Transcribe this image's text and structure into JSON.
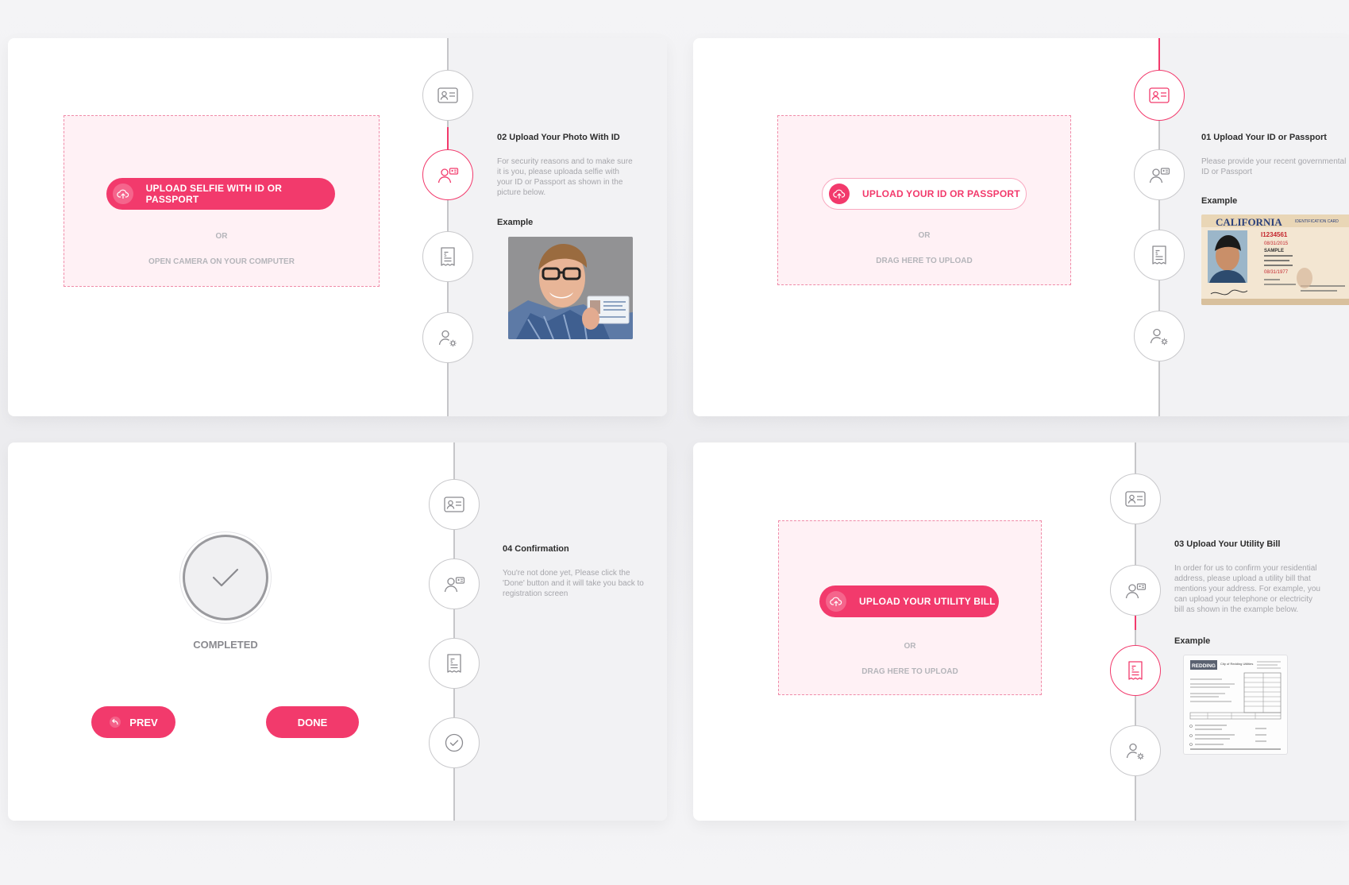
{
  "colors": {
    "accent": "#f23a6c",
    "dropzone_bg": "#fff1f5",
    "sidebar_bg": "#f2f2f4",
    "muted_text": "#a6a6ab"
  },
  "step_icons": [
    "id-card-icon",
    "selfie-with-id-icon",
    "utility-bill-icon",
    "user-settings-icon",
    "checkmark-icon"
  ],
  "panel_selfie": {
    "button_label": "UPLOAD SELFIE WITH ID OR PASSPORT",
    "or_label": "OR",
    "secondary_label": "OPEN CAMERA ON YOUR COMPUTER",
    "step_title": "02 Upload Your Photo With ID",
    "step_desc": "For security reasons and to make sure it is you, please uploada selfie with your ID or Passport as shown in the picture below.",
    "example_label": "Example",
    "active_step": 2
  },
  "panel_id": {
    "button_label": "UPLOAD YOUR ID OR PASSPORT",
    "or_label": "OR",
    "secondary_label": "DRAG HERE TO UPLOAD",
    "step_title": "01 Upload Your ID or Passport",
    "step_desc": "Please provide your recent governmental ID or Passport",
    "example_label": "Example",
    "active_step": 1,
    "license": {
      "state": "CALIFORNIA",
      "tag": "IDENTIFICATION CARD",
      "number": "I1234561",
      "exp": "08/31/2015",
      "name": "SAMPLE",
      "dob": "08/31/1977"
    }
  },
  "panel_confirm": {
    "status_label": "COMPLETED",
    "prev_label": "PREV",
    "done_label": "DONE",
    "step_title": "04 Confirmation",
    "step_desc": "You're not done yet, Please click the 'Done' button and it will take you back to registration screen",
    "active_step": 4
  },
  "panel_bill": {
    "button_label": "UPLOAD YOUR UTILITY BILL",
    "or_label": "OR",
    "secondary_label": "DRAG HERE TO UPLOAD",
    "step_title": "03 Upload Your Utility Bill",
    "step_desc": "In order for us to confirm your residential address, please upload a utility bill that mentions your address. For example, you can upload your telephone or electricity bill as shown in the example below.",
    "example_label": "Example",
    "active_step": 3,
    "bill": {
      "brand": "REDDING",
      "heading": "City of Redding Utilities"
    }
  }
}
